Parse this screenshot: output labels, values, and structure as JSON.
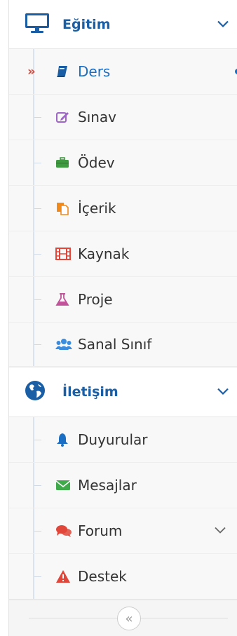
{
  "groups": [
    {
      "label": "Eğitim",
      "icon": "monitor-icon",
      "items": [
        {
          "label": "Ders",
          "icon": "book-icon",
          "active": true
        },
        {
          "label": "Sınav",
          "icon": "edit-icon"
        },
        {
          "label": "Ödev",
          "icon": "briefcase-icon"
        },
        {
          "label": "İçerik",
          "icon": "files-icon"
        },
        {
          "label": "Kaynak",
          "icon": "film-icon"
        },
        {
          "label": "Proje",
          "icon": "flask-icon"
        },
        {
          "label": "Sanal Sınıf",
          "icon": "users-icon"
        }
      ]
    },
    {
      "label": "İletişim",
      "icon": "globe-icon",
      "items": [
        {
          "label": "Duyurular",
          "icon": "bell-icon"
        },
        {
          "label": "Mesajlar",
          "icon": "envelope-icon"
        },
        {
          "label": "Forum",
          "icon": "comments-icon",
          "has_submenu": true
        },
        {
          "label": "Destek",
          "icon": "warning-icon"
        }
      ]
    }
  ],
  "colors": {
    "accent": "#1a5fa6",
    "active_text": "#1a6fc4",
    "active_arrow": "#e2473b"
  },
  "footer": {
    "collapse_glyph": "«"
  }
}
